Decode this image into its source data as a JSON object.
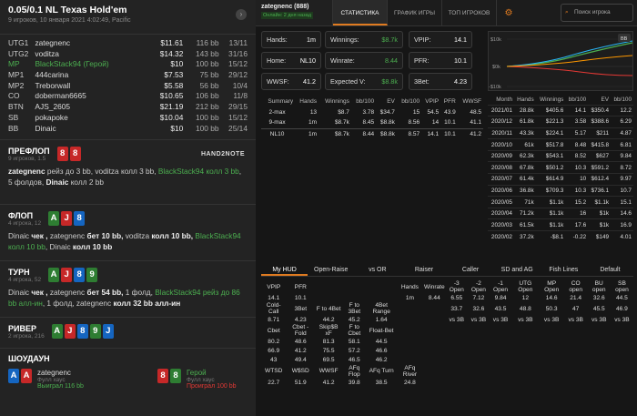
{
  "hand": {
    "title": "0.05/0.1 NL Texas Hold'em",
    "subtitle": "9 игроков, 10 января 2021 4:02:49, Pacific"
  },
  "players": [
    {
      "pos": "UTG1",
      "name": "zategnenc",
      "stack": "$11.61",
      "bb": "116 bb",
      "spr": "13/11"
    },
    {
      "pos": "UTG2",
      "name": "voditza",
      "stack": "$14.32",
      "bb": "143 bb",
      "spr": "31/16"
    },
    {
      "pos": "MP",
      "name": "BlackStack94 (Герой)",
      "stack": "$10",
      "bb": "100 bb",
      "spr": "15/12",
      "hero": true
    },
    {
      "pos": "MP1",
      "name": "444carina",
      "stack": "$7.53",
      "bb": "75 bb",
      "spr": "29/12"
    },
    {
      "pos": "MP2",
      "name": "Treborwall",
      "stack": "$5.58",
      "bb": "56 bb",
      "spr": "10/4"
    },
    {
      "pos": "CO",
      "name": "doberman6665",
      "stack": "$10.65",
      "bb": "106 bb",
      "spr": "11/8"
    },
    {
      "pos": "BTN",
      "name": "AJS_2605",
      "stack": "$21.19",
      "bb": "212 bb",
      "spr": "29/15"
    },
    {
      "pos": "SB",
      "name": "pokapoke",
      "stack": "$10.04",
      "bb": "100 bb",
      "spr": "15/12"
    },
    {
      "pos": "BB",
      "name": "Dinaic",
      "stack": "$10",
      "bb": "100 bb",
      "spr": "25/14"
    }
  ],
  "preflop": {
    "name": "ПРЕФЛОП",
    "sub": "9 игроков, 1.5",
    "brand": "HAND2NOTE",
    "a1": "zategnenc",
    "t1": " рейз до 3 bb, ",
    "a2": "voditza",
    "t2": " колл 3 bb, ",
    "a3": "BlackStack94 колл 3 bb",
    "t3": ",",
    "l2a": "5 фолдов, ",
    "l2b": "Dinaic",
    "l2c": " колл 2 bb"
  },
  "flop": {
    "name": "ФЛОП",
    "sub": "4 игрока, 12",
    "line1a": "Dinaic",
    "line1b": " чек , ",
    "line1c": "zategnenc",
    "line1d": " бет 10 bb, ",
    "line1e": "voditza",
    "line1f": " колл 10 bb, ",
    "line1g": "BlackStack94",
    "line2a": "колл 10 bb",
    "line2b": ", ",
    "line2c": "Dinaic",
    "line2d": " колл 10 bb"
  },
  "turn": {
    "name": "ТУРН",
    "sub": "4 игрока, 52",
    "l1a": "Dinaic",
    "l1b": " чек , ",
    "l1c": "zategnenc",
    "l1d": " бет 54 bb, ",
    "l1e": "1 фолд, ",
    "l1f": "BlackStack94 рейз до 86",
    "l2a": "bb алл-ин",
    "l2b": ", 1 фолд, ",
    "l2c": "zategnenc",
    "l2d": " колл 32 bb алл-ин"
  },
  "river": {
    "name": "РИВЕР",
    "sub": "2 игрока, 216"
  },
  "showdown": {
    "name": "ШОУДАУН",
    "p1": "zategnenc",
    "p1sub": "Фулл хаус",
    "p1res": "Выиграл 116 bb",
    "p2": "Герой",
    "p2sub": "Фулл хаус",
    "p2res": "Проиграл 100 bb"
  },
  "rtabs": {
    "user": "zategnenc (888)",
    "online": "Онлайн: 2 дня назад",
    "t1": "СТАТИСТИКА",
    "t2": "ГРАФИК ИГРЫ",
    "t3": "ТОП ИГРОКОВ",
    "search": "Поиск игрока"
  },
  "boxes": {
    "hands_l": "Hands:",
    "hands_v": "1m",
    "win_l": "Winnings:",
    "win_v": "$8.7k",
    "vpip_l": "VPIP:",
    "vpip_v": "14.1",
    "home_l": "Home:",
    "home_v": "NL10",
    "wr_l": "Winrate:",
    "wr_v": "8.44",
    "pfr_l": "PFR:",
    "pfr_v": "10.1",
    "wwsf_l": "WWSF:",
    "wwsf_v": "41.2",
    "ev_l": "Expected V:",
    "ev_v": "$8.8k",
    "tb_l": "3Bet:",
    "tb_v": "4.23"
  },
  "summary": {
    "head": [
      "Summary",
      "Hands",
      "Winnings",
      "bb/100",
      "EV",
      "bb/100",
      "VPIP",
      "PFR",
      "WWSF"
    ],
    "rows": [
      [
        "2-max",
        "13",
        "$8.7",
        "3.78",
        "$34.7",
        "15",
        "54.5",
        "43.9",
        "48.5"
      ],
      [
        "9-max",
        "1m",
        "$8.7k",
        "8.45",
        "$8.8k",
        "8.56",
        "14",
        "10.1",
        "41.1"
      ],
      [
        "NL10",
        "1m",
        "$8.7k",
        "8.44",
        "$8.8k",
        "8.57",
        "14.1",
        "10.1",
        "41.2"
      ]
    ]
  },
  "chart": {
    "y_top": "$10k",
    "y_mid": "$0k",
    "y_bot": "-$10k",
    "bb": "BB"
  },
  "monthly": {
    "head": [
      "Month",
      "Hands",
      "Winnings",
      "bb/100",
      "EV",
      "bb/100"
    ],
    "rows": [
      [
        "2021/01",
        "28.8k",
        "$405.6",
        "14.1",
        "$350.4",
        "12.2"
      ],
      [
        "2020/12",
        "61.8k",
        "$221.3",
        "3.58",
        "$388.6",
        "6.29"
      ],
      [
        "2020/11",
        "43.3k",
        "$224.1",
        "5.17",
        "$211",
        "4.87"
      ],
      [
        "2020/10",
        "61k",
        "$517.8",
        "8.48",
        "$415.8",
        "6.81"
      ],
      [
        "2020/09",
        "62.3k",
        "$543.1",
        "8.52",
        "$627",
        "9.84"
      ],
      [
        "2020/08",
        "67.8k",
        "$501.2",
        "10.3",
        "$591.2",
        "8.72"
      ],
      [
        "2020/07",
        "61.4k",
        "$614.9",
        "10",
        "$612.4",
        "9.97"
      ],
      [
        "2020/06",
        "36.8k",
        "$709.3",
        "10.3",
        "$736.1",
        "10.7"
      ],
      [
        "2020/05",
        "71k",
        "$1.1k",
        "15.2",
        "$1.1k",
        "15.1"
      ],
      [
        "2020/04",
        "71.2k",
        "$1.1k",
        "16",
        "$1k",
        "14.6"
      ],
      [
        "2020/03",
        "61.5k",
        "$1.1k",
        "17.6",
        "$1k",
        "16.9"
      ],
      [
        "2020/02",
        "37.2k",
        "-$8.1",
        "-0.22",
        "$149",
        "4.01"
      ]
    ]
  },
  "hudtabs": [
    "My HUD",
    "Open-Raise",
    "vs OR",
    "Raiser",
    "Caller",
    "SD and AG",
    "Fish Lines",
    "Default"
  ],
  "hud": {
    "r1": [
      "VPIP",
      "PFR",
      "",
      "",
      "",
      "Hands",
      "Winrate",
      "-3 Open",
      "-2 Open",
      "-1 Open",
      "UTG Open",
      "MP Open",
      "CO open",
      "BU open",
      "SB open"
    ],
    "r2": [
      "14.1",
      "10.1",
      "",
      "",
      "",
      "1m",
      "8.44",
      "6.55",
      "7.12",
      "9.84",
      "12",
      "14.6",
      "21.4",
      "32.6",
      "44.5"
    ],
    "r3": [
      "Cold-Call",
      "3Bet",
      "F to 4Bet",
      "F to 3Bet",
      "4Bet Range",
      "",
      "",
      "33.7",
      "32.6",
      "43.5",
      "48.8",
      "50.3",
      "47",
      "45.5",
      "46.9"
    ],
    "r4": [
      "8.71",
      "4.23",
      "44.2",
      "45.2",
      "1.64",
      "",
      "",
      "vs 3B",
      "vs 3B",
      "vs 3B",
      "vs 3B",
      "vs 3B",
      "vs 3B",
      "vs 3B",
      "vs 3B"
    ],
    "r5": [
      "Cbet",
      "Cbet - Fold",
      "Skip$B xF",
      "F to Cbet",
      "Float-Bet"
    ],
    "r6": [
      "80.2",
      "48.6",
      "81.3",
      "58.1",
      "44.5"
    ],
    "r7": [
      "66.9",
      "41.2",
      "75.5",
      "57.2",
      "46.6"
    ],
    "r8": [
      "43",
      "49.4",
      "69.5",
      "46.5",
      "46.2"
    ],
    "r9": [
      "WTSD",
      "W$SD",
      "WWSF",
      "AFq Flop",
      "AFq Turn",
      "AFq River"
    ],
    "r10": [
      "22.7",
      "51.9",
      "41.2",
      "39.8",
      "38.5",
      "24.8"
    ]
  }
}
